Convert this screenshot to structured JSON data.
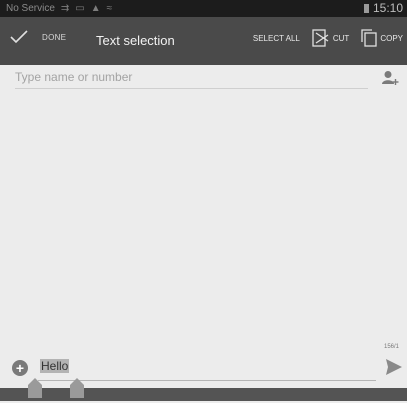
{
  "status": {
    "carrier": "No Service",
    "time": "15:10"
  },
  "action_bar": {
    "done_label": "DONE",
    "title": "Text selection",
    "select_all_label": "SELECT ALL",
    "cut_label": "CUT",
    "copy_label": "COPY"
  },
  "recipient": {
    "placeholder": "Type name or number"
  },
  "compose": {
    "char_counter": "156/1",
    "text": "Hello",
    "selected_text": "Hello"
  },
  "colors": {
    "action_bar": "#4a4a4a",
    "status_bar": "#1c1c1c",
    "background": "#ececec",
    "selection": "#b3b3b3"
  },
  "icons": [
    "check-icon",
    "cut-icon",
    "copy-icon",
    "add-contact-icon",
    "plus-icon",
    "send-icon",
    "selection-handle-icon"
  ]
}
